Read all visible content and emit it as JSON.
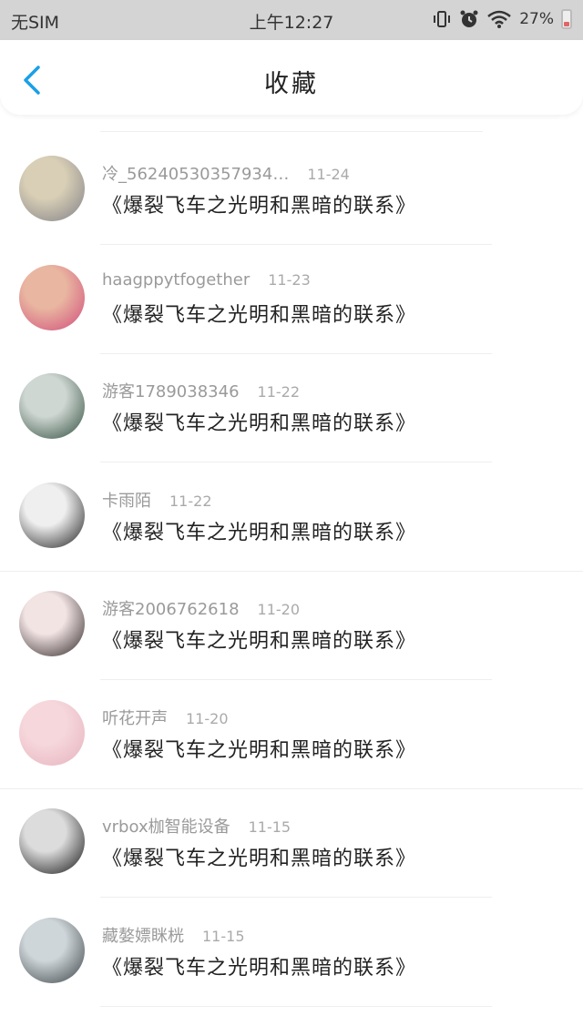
{
  "status_bar": {
    "carrier": "无SIM",
    "time": "上午12:27",
    "battery": "27%",
    "battery_level": 0.27,
    "icons": [
      "vibrate-icon",
      "alarm-icon",
      "wifi-icon",
      "battery-icon"
    ]
  },
  "header": {
    "back_icon": "chevron-left-icon",
    "title": "收藏",
    "accent_color": "#1aa0e6"
  },
  "favorites": [
    {
      "user": "冷_56240530357934…",
      "date": "11-24",
      "title": "《爆裂飞车之光明和黑暗的联系》",
      "avatar_colors": [
        "#d9cfb6",
        "#7f7f86"
      ]
    },
    {
      "user": "haagppytfogether",
      "date": "11-23",
      "title": "《爆裂飞车之光明和黑暗的联系》",
      "avatar_colors": [
        "#e9b7a1",
        "#d14a7a"
      ]
    },
    {
      "user": "游客1789038346",
      "date": "11-22",
      "title": "《爆裂飞车之光明和黑暗的联系》",
      "avatar_colors": [
        "#cfd7d2",
        "#2d4b3c"
      ]
    },
    {
      "user": "卡雨陌",
      "date": "11-22",
      "title": "《爆裂飞车之光明和黑暗的联系》",
      "avatar_colors": [
        "#efefef",
        "#1b1b1b"
      ]
    },
    {
      "user": "游客2006762618",
      "date": "11-20",
      "title": "《爆裂飞车之光明和黑暗的联系》",
      "avatar_colors": [
        "#f3e4e4",
        "#2b2323"
      ]
    },
    {
      "user": "听花开声",
      "date": "11-20",
      "title": "《爆裂飞车之光明和黑暗的联系》",
      "avatar_colors": [
        "#f6d8dc",
        "#e6b2be"
      ]
    },
    {
      "user": "vrbox枷智能设备",
      "date": "11-15",
      "title": "《爆裂飞车之光明和黑暗的联系》",
      "avatar_colors": [
        "#dcdcdc",
        "#111111"
      ]
    },
    {
      "user": "藏嫯嫖眯桄",
      "date": "11-15",
      "title": "《爆裂飞车之光明和黑暗的联系》",
      "avatar_colors": [
        "#cfd6d9",
        "#3a4146"
      ]
    }
  ]
}
